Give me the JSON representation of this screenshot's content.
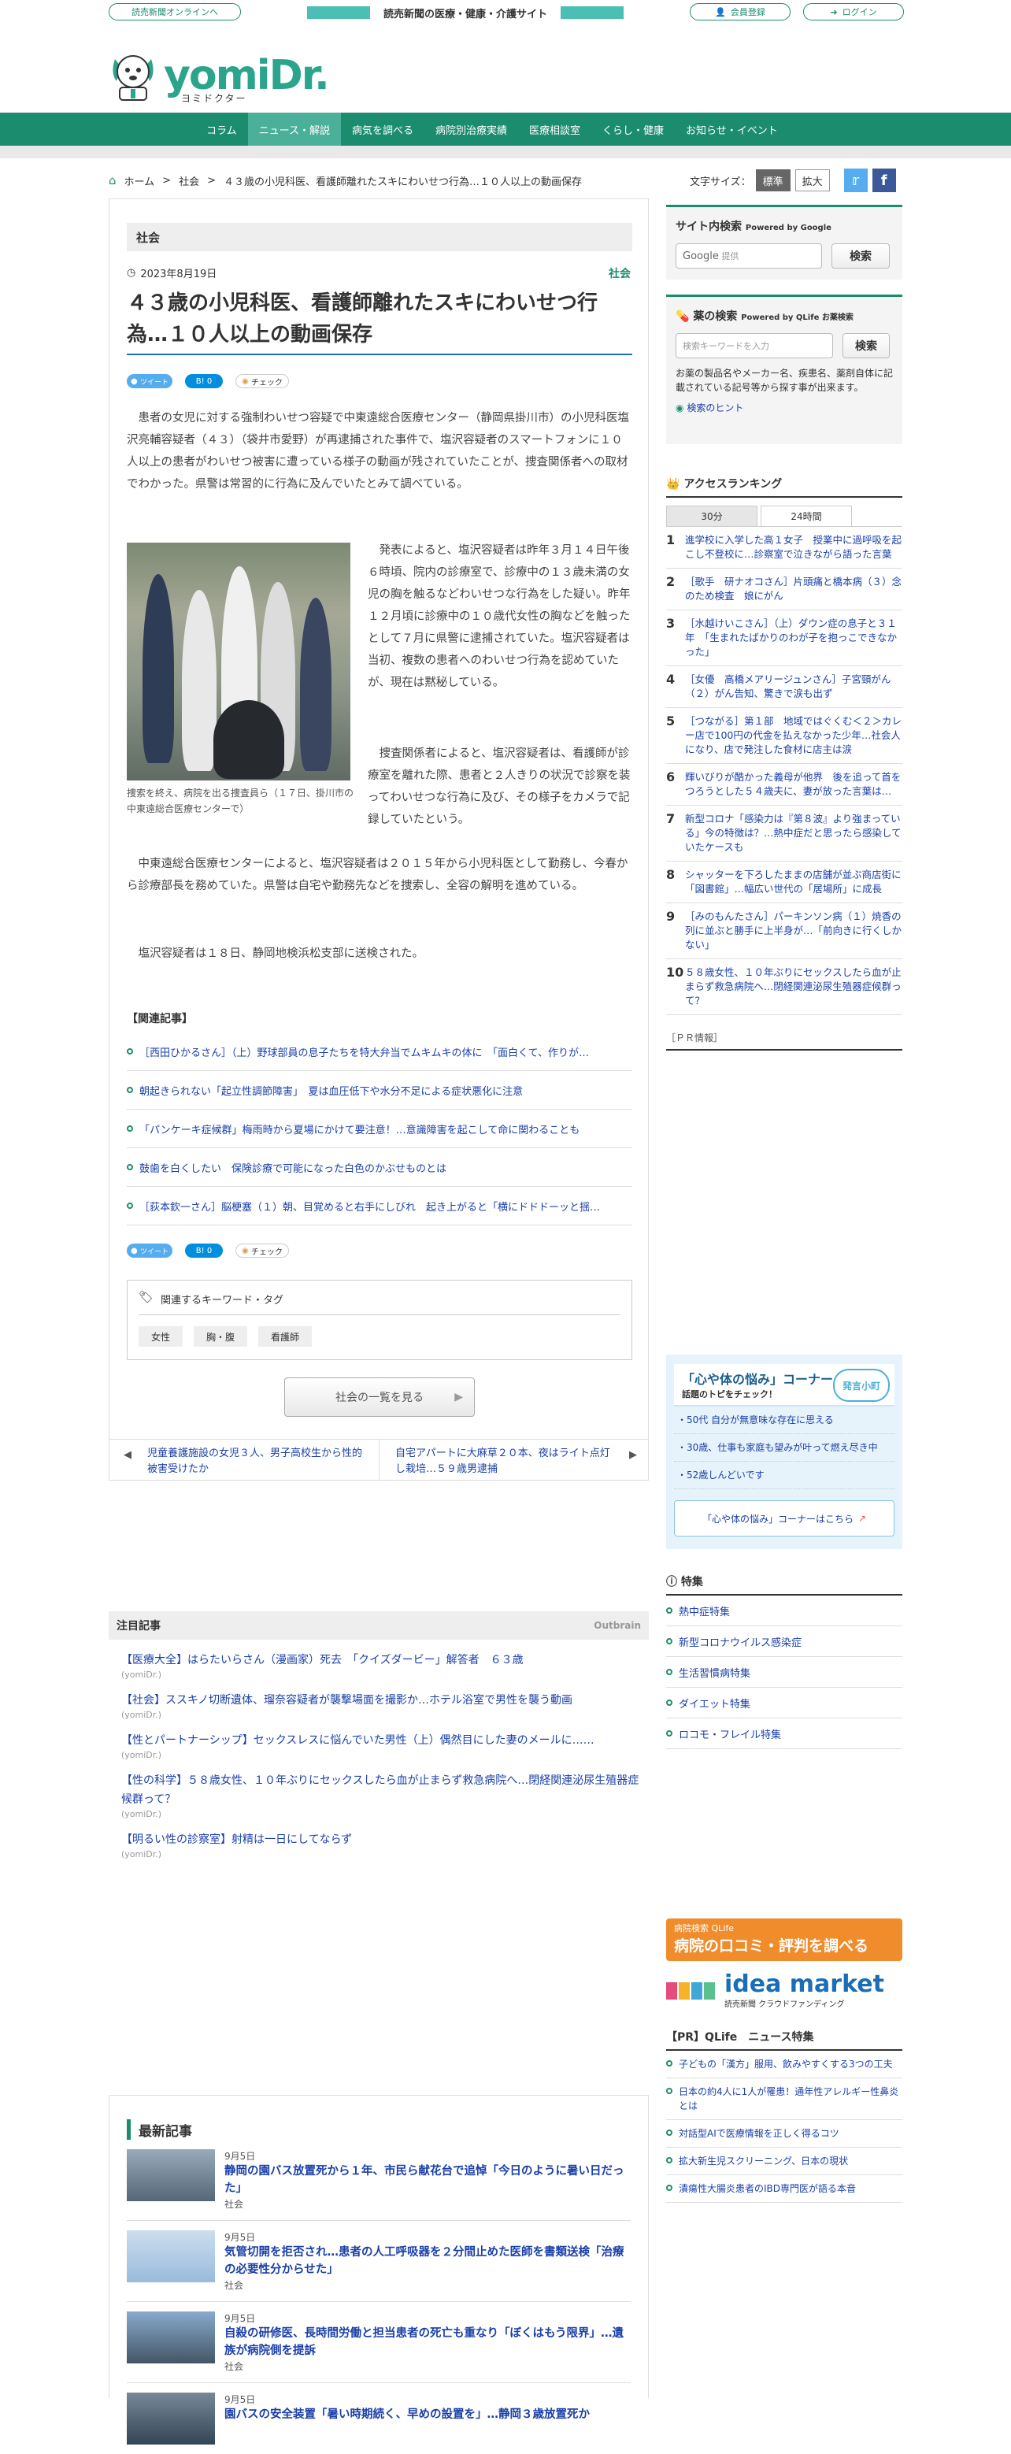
{
  "topbar": {
    "online_link": "読売新聞オンラインへ",
    "banner": "読売新聞の医療・健康・介護サイト",
    "register": "会員登録",
    "login": "ログイン"
  },
  "logo": {
    "main": "yomiDr.",
    "sub": "ヨミドクター"
  },
  "nav": [
    "コラム",
    "ニュース・解説",
    "病気を調べる",
    "病院別治療実績",
    "医療相談室",
    "くらし・健康",
    "お知らせ・イベント"
  ],
  "breadcrumb": {
    "home": "ホーム",
    "sep": ">",
    "cat": "社会",
    "current": "４３歳の小児科医、看護師離れたスキにわいせつ行為…１０人以上の動画保存"
  },
  "fontsize": {
    "label": "文字サイズ：",
    "standard": "標準",
    "large": "拡大"
  },
  "article": {
    "section": "社会",
    "date": "2023年8月19日",
    "category": "社会",
    "title": "４３歳の小児科医、看護師離れたスキにわいせつ行為…１０人以上の動画保存",
    "share": {
      "tweet": "ツイート",
      "hatena": "B! 0",
      "check": "チェック"
    },
    "p1": "患者の女児に対する強制わいせつ容疑で中東遠総合医療センター（静岡県掛川市）の小児科医塩沢亮輔容疑者（４３）（袋井市愛野）が再逮捕された事件で、塩沢容疑者のスマートフォンに１０人以上の患者がわいせつ被害に遭っている様子の動画が残されていたことが、捜査関係者への取材でわかった。県警は常習的に行為に及んでいたとみて調べている。",
    "p2": "発表によると、塩沢容疑者は昨年３月１４日午後６時頃、院内の診療室で、診療中の１３歳未満の女児の胸を触るなどわいせつな行為をした疑い。昨年１２月頃に診療中の１０歳代女性の胸などを触ったとして７月に県警に逮捕されていた。塩沢容疑者は当初、複数の患者へのわいせつ行為を認めていたが、現在は黙秘している。",
    "p3": "捜査関係者によると、塩沢容疑者は、看護師が診療室を離れた際、患者と２人きりの状況で診察を装ってわいせつな行為に及び、その様子をカメラで記録していたという。",
    "p4": "中東遠総合医療センターによると、塩沢容疑者は２０１５年から小児科医として勤務し、今春から診療部長を務めていた。県警は自宅や勤務先などを捜索し、全容の解明を進めている。",
    "p5": "塩沢容疑者は１８日、静岡地検浜松支部に送検された。",
    "caption": "捜索を終え、病院を出る捜査員ら（１７日、掛川市の中東遠総合医療センターで）",
    "related_title": "【関連記事】",
    "related": [
      "［西田ひかるさん］（上）野球部員の息子たちを特大弁当でムキムキの体に　「面白くて、作りが…",
      "朝起きられない「起立性調節障害」　夏は血圧低下や水分不足による症状悪化に注意",
      "「パンケーキ症候群」梅雨時から夏場にかけて要注意！…意識障害を起こして命に関わることも",
      "鼓歯を白くしたい　保険診療で可能になった白色のかぶせものとは",
      "［荻本欽一さん］脳梗塞（１）朝、目覚めると右手にしびれ　起き上がると「横にドドドーッと揺…"
    ],
    "keywords_title": "関連するキーワード・タグ",
    "keywords": [
      "女性",
      "胸・腹",
      "看護師"
    ],
    "more": "社会の一覧を見る",
    "prev": "児童養護施設の女児３人、男子高校生から性的被害受けたか",
    "next": "自宅アパートに大麻草２０本、夜はライト点灯し栽培…５９歳男逮捕"
  },
  "sidebar": {
    "search_title": "サイト内検索",
    "search_powered": "Powered by Google",
    "google": "Google",
    "google_ph": "提供",
    "search_btn": "検索",
    "drug_title": "薬の検索",
    "drug_powered": "Powered by QLife お薬検索",
    "drug_ph": "検索キーワードを入力",
    "drug_btn": "検索",
    "drug_desc": "お薬の製品名やメーカー名、疾患名、薬剤自体に記載されている記号等から探す事が出来ます。",
    "drug_hint": "検索のヒント",
    "rank_title": "アクセスランキング",
    "rank_tabs": [
      "30分",
      "24時間"
    ],
    "ranking": [
      "進学校に入学した高１女子　授業中に過呼吸を起こし不登校に…診察室で泣きながら語った言葉",
      "［歌手　研ナオコさん］片頭痛と橋本病（３）念のため検査　娘にがん",
      "［水越けいこさん］（上）ダウン症の息子と３１年　「生まれたばかりのわが子を抱っこできなかった」",
      "［女優　高橋メアリージュンさん］子宮頸がん（２）がん告知、驚きで涙も出ず",
      "［つながる］第１部　地域ではぐくむ＜２＞カレー店で100円の代金を払えなかった少年…社会人になり、店で発注した食材に店主は涙",
      "輝いびりが酷かった義母が他界　後を追って首をつろうとした５４歳夫に、妻が放った言葉は…",
      "新型コロナ「感染力は『第８波』より強まっている」今の特徴は？…熱中症だと思ったら感染していたケースも",
      "シャッターを下ろしたままの店舗が並ぶ商店街に「図書館」…幅広い世代の「居場所」に成長",
      "［みのもんたさん］パーキンソン病（１）焼香の列に並ぶと勝手に上半身が…「前向きに行くしかない」",
      "５８歳女性、１０年ぶりにセックスしたら血が止まらず救急病院へ…閉経関連泌尿生殖器症候群って？"
    ],
    "pr_info": "［ＰＲ情報］",
    "kokoro_title": "「心や体の悩み」コーナー",
    "kokoro_sub": "話題のトピをチェック！",
    "kokoro_badge": "発言小町",
    "kokoro_items": [
      "50代 自分が無意味な存在に思える",
      "30歳、仕事も家庭も望みが叶って燃え尽き中",
      "52歳しんどいです"
    ],
    "kokoro_link": "「心や体の悩み」コーナーはこちら",
    "feature_title": "特集",
    "features": [
      "熱中症特集",
      "新型コロナウイルス感染症",
      "生活習慣病特集",
      "ダイエット特集",
      "ロコモ・フレイル特集"
    ],
    "hospital_banner_small": "病院検索 QLife",
    "hospital_banner": "病院の口コミ・評判を調べる",
    "idea_main": "idea market",
    "idea_sub": "読売新聞 クラウドファンディング",
    "qlife_title": "【PR】QLife　ニュース特集",
    "qlife_items": [
      "子どもの「漢方」服用、飲みやすくする3つの工夫",
      "日本の約4人に1人が罹患！通年性アレルギー性鼻炎とは",
      "対話型AIで医療情報を正しく得るコツ",
      "拡大新生児スクリーニング、日本の現状",
      "潰瘍性大腸炎患者のIBD専門医が語る本音"
    ]
  },
  "outbrain": {
    "title": "注目記事",
    "brand": "Outbrain",
    "items": [
      {
        "title": "【医療大全】はらたいらさん（漫画家）死去　「クイズダービー」解答者　６３歳",
        "source": "(yomiDr.)"
      },
      {
        "title": "【社会】ススキノ切断遺体、瑠奈容疑者が襲撃場面を撮影か…ホテル浴室で男性を襲う動画",
        "source": "(yomiDr.)"
      },
      {
        "title": "【性とパートナーシップ】セックスレスに悩んでいた男性（上）偶然目にした妻のメールに……",
        "source": "(yomiDr.)"
      },
      {
        "title": "【性の科学】５８歳女性、１０年ぶりにセックスしたら血が止まらず救急病院へ…閉経関連泌尿生殖器症候群って？",
        "source": "(yomiDr.)"
      },
      {
        "title": "【明るい性の診察室】射精は一日にしてならず",
        "source": "(yomiDr.)"
      }
    ]
  },
  "latest": {
    "title": "最新記事",
    "items": [
      {
        "date": "9月5日",
        "title": "静岡の園バス放置死から１年、市民ら献花台で追悼「今日のように暑い日だった」",
        "cat": "社会"
      },
      {
        "date": "9月5日",
        "title": "気管切開を拒否され…患者の人工呼吸器を２分間止めた医師を書類送検「治療の必要性分からせた」",
        "cat": "社会"
      },
      {
        "date": "9月5日",
        "title": "自殺の研修医、長時間労働と担当患者の死亡も重なり「ぼくはもう限界」…遺族が病院側を提訴",
        "cat": "社会"
      },
      {
        "date": "9月5日",
        "title": "園バスの安全装置「暑い時期続く、早めの設置を」…静岡３歳放置死か",
        "cat": ""
      }
    ]
  },
  "colors": {
    "brand": "#1c8c6f",
    "link": "#1a3fa8"
  }
}
